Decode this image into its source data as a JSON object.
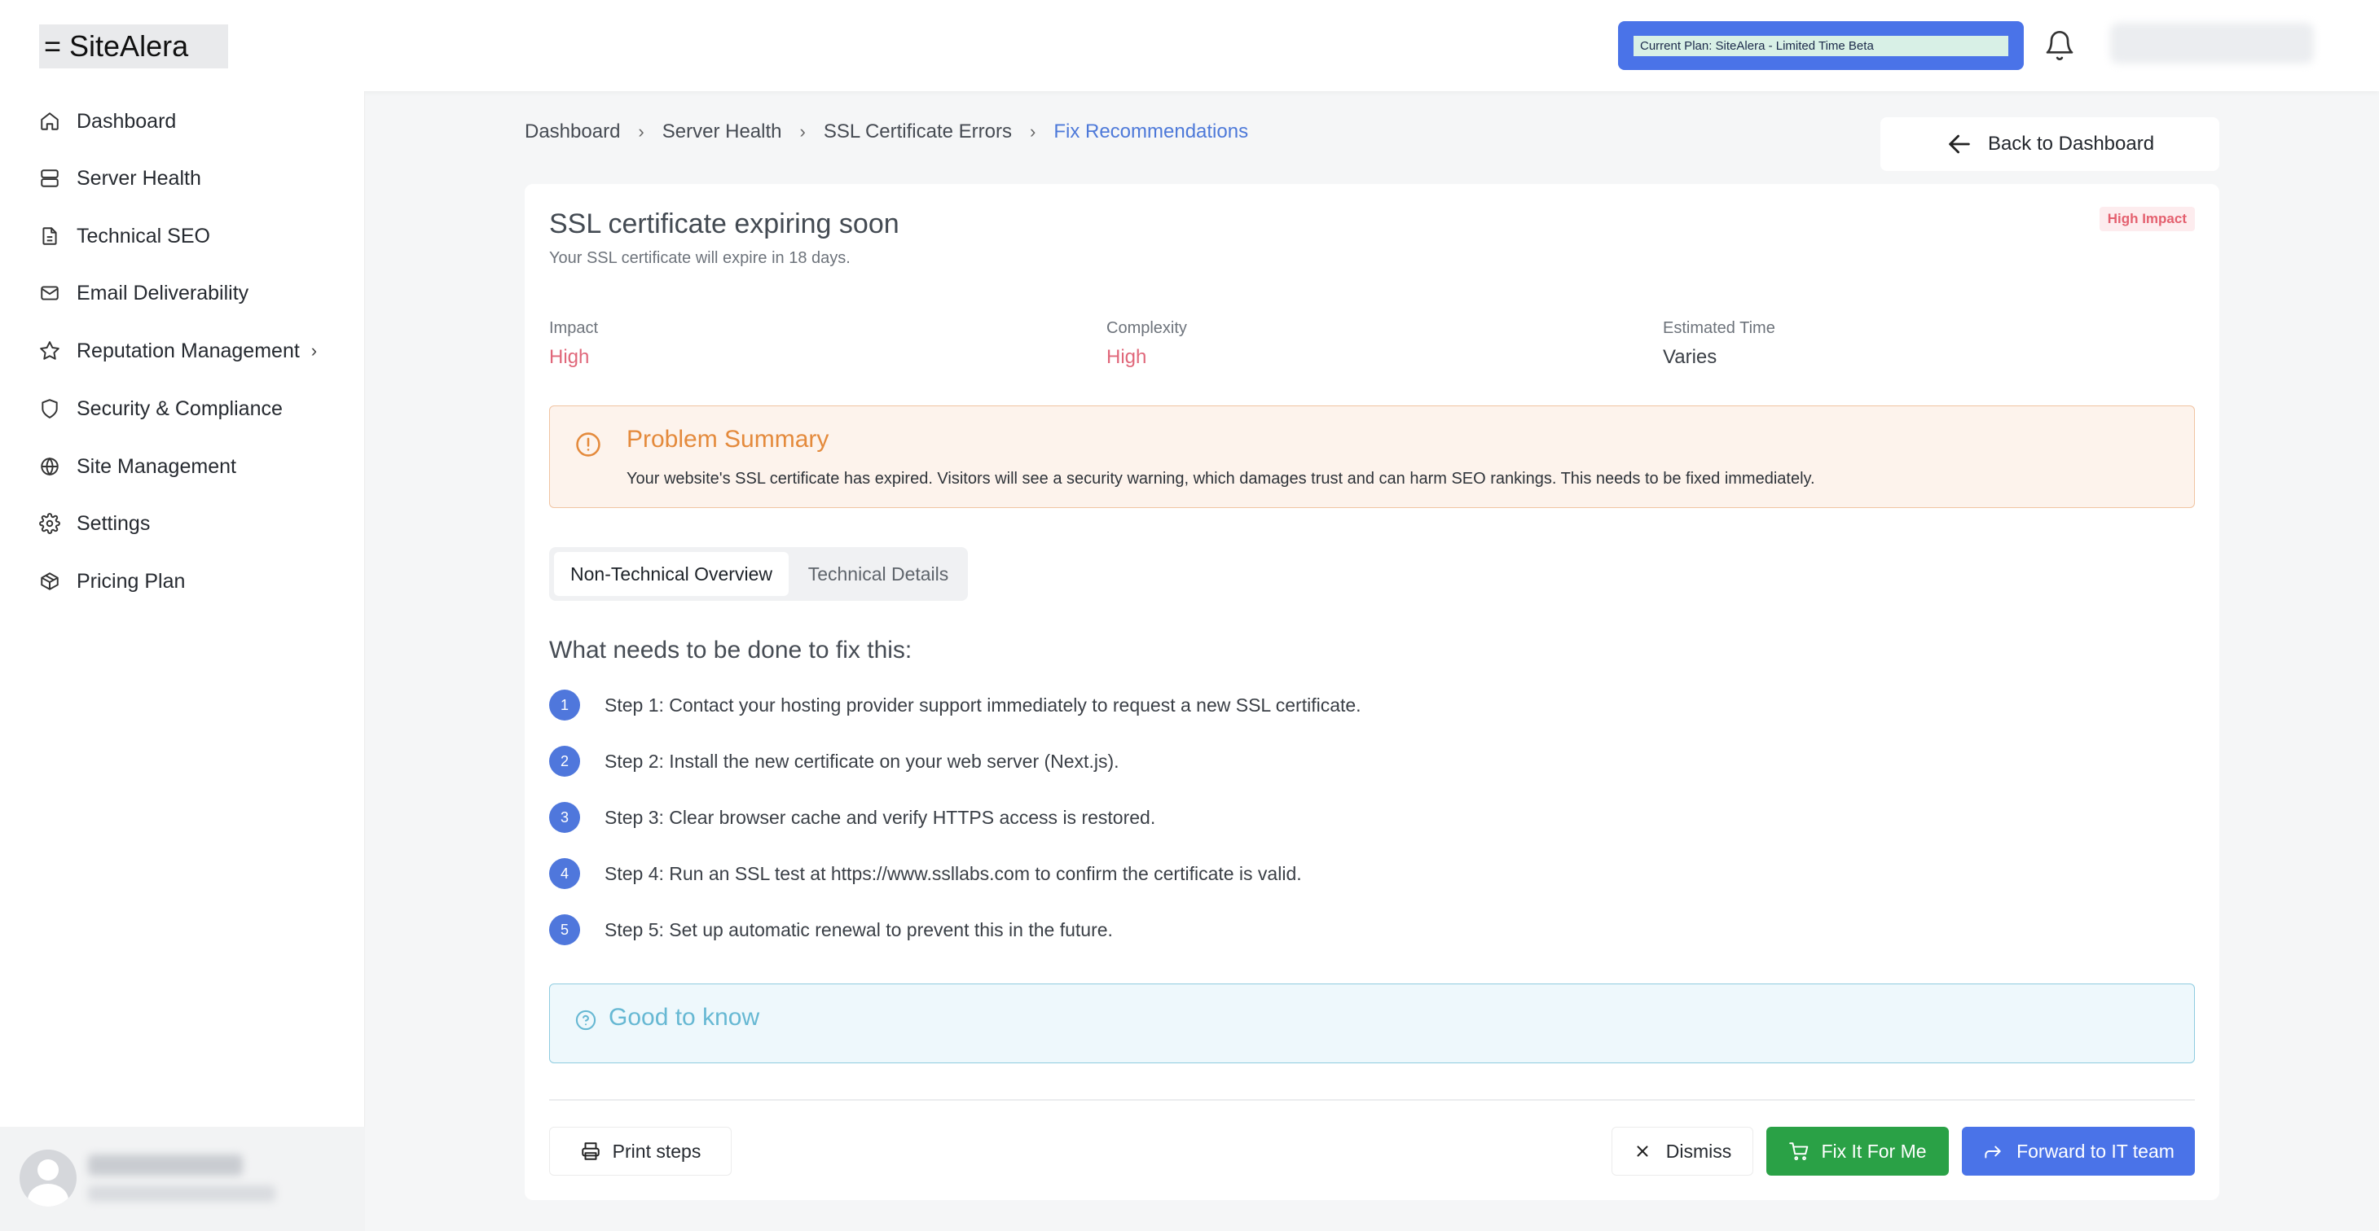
{
  "app": {
    "logo": "= SiteAlera",
    "plan_label": "Current Plan: SiteAlera - Limited Time Beta"
  },
  "sidebar": {
    "items": [
      {
        "label": "Dashboard",
        "icon": "home-icon"
      },
      {
        "label": "Server Health",
        "icon": "server-icon"
      },
      {
        "label": "Technical SEO",
        "icon": "document-icon"
      },
      {
        "label": "Email Deliverability",
        "icon": "mail-icon"
      },
      {
        "label": "Reputation Management",
        "icon": "star-icon"
      },
      {
        "label": "Security & Compliance",
        "icon": "shield-icon"
      },
      {
        "label": "Site Management",
        "icon": "globe-icon"
      },
      {
        "label": "Settings",
        "icon": "gear-icon"
      },
      {
        "label": "Pricing Plan",
        "icon": "package-icon"
      }
    ]
  },
  "breadcrumb": [
    "Dashboard",
    "Server Health",
    "SSL Certificate Errors",
    "Fix Recommendations"
  ],
  "back_button": "Back to Dashboard",
  "issue": {
    "title": "SSL certificate expiring soon",
    "subtitle": "Your SSL certificate will expire in 18 days.",
    "badge": "High Impact",
    "meta": [
      {
        "label": "Impact",
        "value": "High"
      },
      {
        "label": "Complexity",
        "value": "High"
      },
      {
        "label": "Estimated Time",
        "value": "Varies"
      }
    ]
  },
  "problem": {
    "title": "Problem Summary",
    "text": "Your website's SSL certificate has expired. Visitors will see a security warning, which damages trust and can harm SEO rankings. This needs to be fixed immediately."
  },
  "tabs": [
    "Non-Technical Overview",
    "Technical Details"
  ],
  "fix": {
    "heading": "What needs to be done to fix this:",
    "steps": [
      {
        "num": "1",
        "text": "Step 1: Contact your hosting provider support immediately to request a new SSL certificate."
      },
      {
        "num": "2",
        "text": "Step 2: Install the new certificate on your web server (Next.js)."
      },
      {
        "num": "3",
        "text": "Step 3: Clear browser cache and verify HTTPS access is restored."
      },
      {
        "num": "4",
        "text": "Step 4: Run an SSL test at https://www.ssllabs.com to confirm the certificate is valid."
      },
      {
        "num": "5",
        "text": "Step 5: Set up automatic renewal to prevent this in the future."
      }
    ]
  },
  "good_to_know": "Good to know",
  "actions": {
    "print": "Print steps",
    "dismiss": "Dismiss",
    "fix_it": "Fix It For Me",
    "forward": "Forward to IT team"
  },
  "colors": {
    "accent": "#4a73e8",
    "danger": "#e0677a",
    "success": "#2aa146",
    "warning": "#e48a3c",
    "info": "#66b8d3"
  }
}
